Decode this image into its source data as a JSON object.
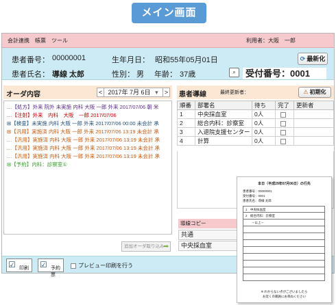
{
  "badge": {
    "title": "メイン画面"
  },
  "menubar": {
    "items": [
      "会計連携",
      "帳票",
      "ツール"
    ],
    "user_label": "利用者：大阪　一郎"
  },
  "patient": {
    "id_label": "患者番号：",
    "id_value": "00000001",
    "name_label": "患者氏名：",
    "name_value": "導線 太郎",
    "dob_label": "生年月日：",
    "dob_value": "昭和55年05月01日",
    "sex_label": "性別：",
    "sex_value": "男",
    "age_label": "年齢：",
    "age_value": "37歳",
    "refresh_label": "最新化",
    "reception_label": "受付番号：",
    "reception_value": "0001"
  },
  "order": {
    "title": "オーダ内容",
    "date": "2017年 7月 6日",
    "rows": [
      {
        "text": "…【処方】外来 院外 未実施 内科 大阪 一郎 外来 2017/07/06 朝 米",
        "color": "c-purple"
      },
      {
        "text": "…【注射】外来　内科　大阪　一郎 2017/07/06",
        "color": "c-red"
      },
      {
        "text": "⊞【検査】未実施 内科 大阪 一郎 外来 2017/07/06 00:00 未会計 承",
        "color": "c-blue"
      },
      {
        "text": "⊞【汎用】実施済 内科 大阪 一郎 外来 2017/07/06 13:19 未会計 承",
        "color": "c-orange"
      },
      {
        "text": "…【汎用】実施済 内科 大阪 一郎 外来 2017/07/06 13:19 未会計 承",
        "color": "c-orange"
      },
      {
        "text": "…【汎用】実施済 内科 大阪 一郎 外来 2017/07/06 13:19 未会計 承",
        "color": "c-orange"
      },
      {
        "text": "…【汎用】実施済 内科 大阪 一郎 外来 2017/07/06 13:19 未会計 承",
        "color": "c-orange"
      },
      {
        "text": "⊞【予約】内科：診察室①",
        "color": "c-green"
      }
    ],
    "add_label": "追加オーダ取り込み"
  },
  "guide": {
    "title": "患者導線",
    "updater_label": "最終更新者：",
    "init_label": "初期化",
    "columns": [
      "順番",
      "部署名",
      "待ち",
      "完了",
      "更新者"
    ],
    "rows": [
      {
        "order": "1",
        "dept": "中央採血室",
        "wait": "0人"
      },
      {
        "order": "2",
        "dept": "総合内科：診察室",
        "wait": "0人"
      },
      {
        "order": "3",
        "dept": "入退院支援センター",
        "wait": "0人"
      },
      {
        "order": "4",
        "dept": "計算",
        "wait": "0人"
      }
    ]
  },
  "copy": {
    "title": "導線コピー",
    "items": [
      "共通",
      "中央採血室"
    ]
  },
  "footer": {
    "print_label": "印刷",
    "reserve_label": "予約票",
    "preview_label": "プレビュー印刷を行う"
  },
  "receipt": {
    "title": "本日（平成29年07月06日）の行先",
    "info": [
      "患者番号：00000001",
      "受付番号：0001",
      "患者氏名：導線 太郎"
    ],
    "lines": [
      "1　中央採血室",
      "2　総合内科：診察室",
      "　　－以上－"
    ],
    "note1": "※ わからない点がございましたら",
    "note2": "お近くの職員にお尋ねください"
  }
}
